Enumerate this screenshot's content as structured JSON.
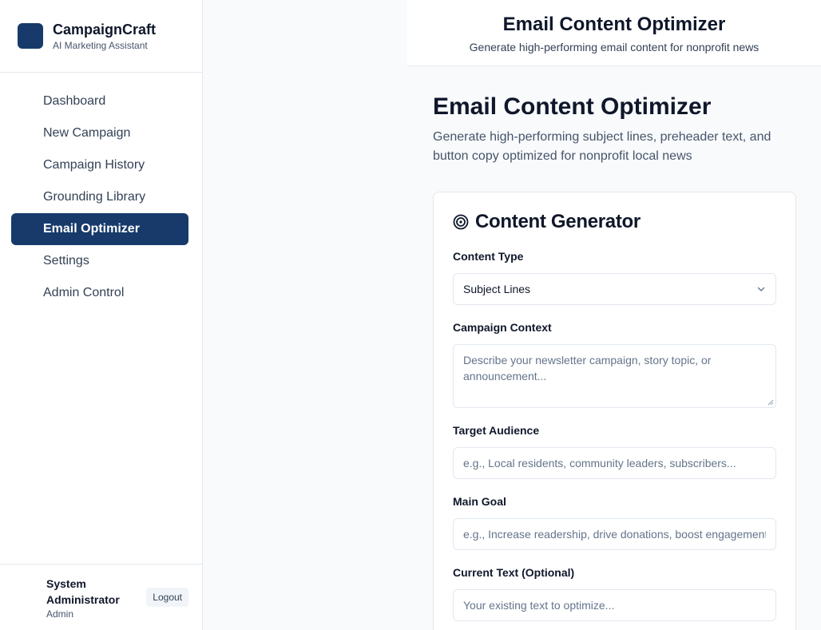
{
  "brand": {
    "name": "CampaignCraft",
    "subtitle": "AI Marketing Assistant"
  },
  "nav": {
    "items": [
      {
        "label": "Dashboard"
      },
      {
        "label": "New Campaign"
      },
      {
        "label": "Campaign History"
      },
      {
        "label": "Grounding Library"
      },
      {
        "label": "Email Optimizer",
        "active": true
      },
      {
        "label": "Settings"
      },
      {
        "label": "Admin Control"
      }
    ]
  },
  "user": {
    "name": "System Administrator",
    "role": "Admin",
    "logout_label": "Logout"
  },
  "header": {
    "title": "Email Content Optimizer",
    "subtitle": "Generate high-performing email content for nonprofit news"
  },
  "page": {
    "title": "Email Content Optimizer",
    "description": "Generate high-performing subject lines, preheader text, and button copy optimized for nonprofit local news"
  },
  "card": {
    "title": "Content Generator",
    "icon": "target-icon",
    "fields": {
      "content_type": {
        "label": "Content Type",
        "value": "Subject Lines"
      },
      "campaign_context": {
        "label": "Campaign Context",
        "placeholder": "Describe your newsletter campaign, story topic, or announcement..."
      },
      "target_audience": {
        "label": "Target Audience",
        "placeholder": "e.g., Local residents, community leaders, subscribers..."
      },
      "main_goal": {
        "label": "Main Goal",
        "placeholder": "e.g., Increase readership, drive donations, boost engagement..."
      },
      "current_text": {
        "label": "Current Text (Optional)",
        "placeholder": "Your existing text to optimize..."
      }
    }
  },
  "colors": {
    "accent": "#173a6b",
    "background": "#f8fafc",
    "border": "#e5e7eb"
  }
}
